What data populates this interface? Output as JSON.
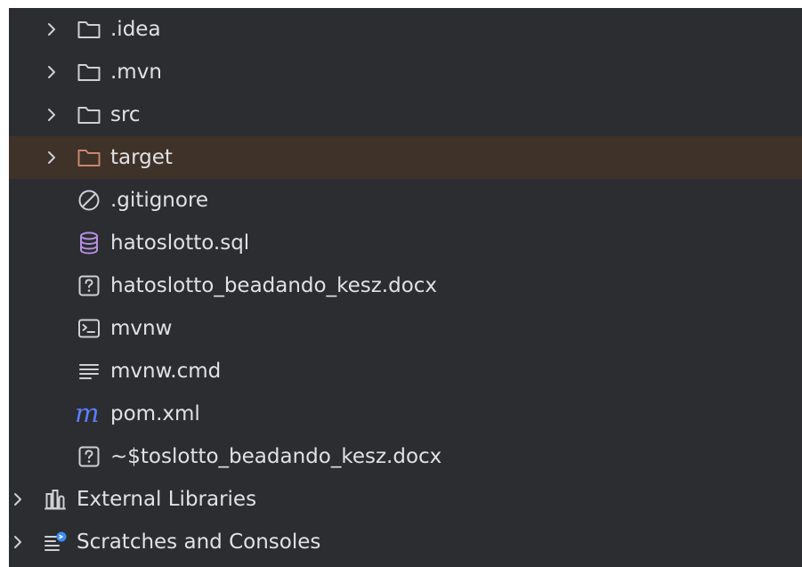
{
  "project_tree": {
    "items": [
      {
        "label": ".idea",
        "icon": "folder-icon",
        "expandable": true
      },
      {
        "label": ".mvn",
        "icon": "folder-icon",
        "expandable": true
      },
      {
        "label": "src",
        "icon": "folder-icon",
        "expandable": true
      },
      {
        "label": "target",
        "icon": "folder-excluded-icon",
        "expandable": true,
        "selected": true
      },
      {
        "label": ".gitignore",
        "icon": "ignored-file-icon",
        "expandable": false
      },
      {
        "label": "hatoslotto.sql",
        "icon": "database-icon",
        "expandable": false
      },
      {
        "label": "hatoslotto_beadando_kesz.docx",
        "icon": "unknown-file-icon",
        "expandable": false
      },
      {
        "label": "mvnw",
        "icon": "terminal-icon",
        "expandable": false
      },
      {
        "label": "mvnw.cmd",
        "icon": "text-file-icon",
        "expandable": false
      },
      {
        "label": "pom.xml",
        "icon": "maven-icon",
        "expandable": false
      },
      {
        "label": "~$toslotto_beadando_kesz.docx",
        "icon": "unknown-file-icon",
        "expandable": false
      }
    ],
    "root_items": [
      {
        "label": "External Libraries",
        "icon": "library-icon",
        "expandable": true
      },
      {
        "label": "Scratches and Consoles",
        "icon": "scratches-icon",
        "expandable": true
      }
    ]
  },
  "colors": {
    "background": "#2b2d30",
    "selected_row": "#3f3228",
    "text": "#dfe1e5",
    "folder": "#ced0d6",
    "excluded_folder": "#c9866b",
    "database": "#b38fe0",
    "maven": "#5c7dff",
    "scratch_badge": "#3d8ef0"
  }
}
